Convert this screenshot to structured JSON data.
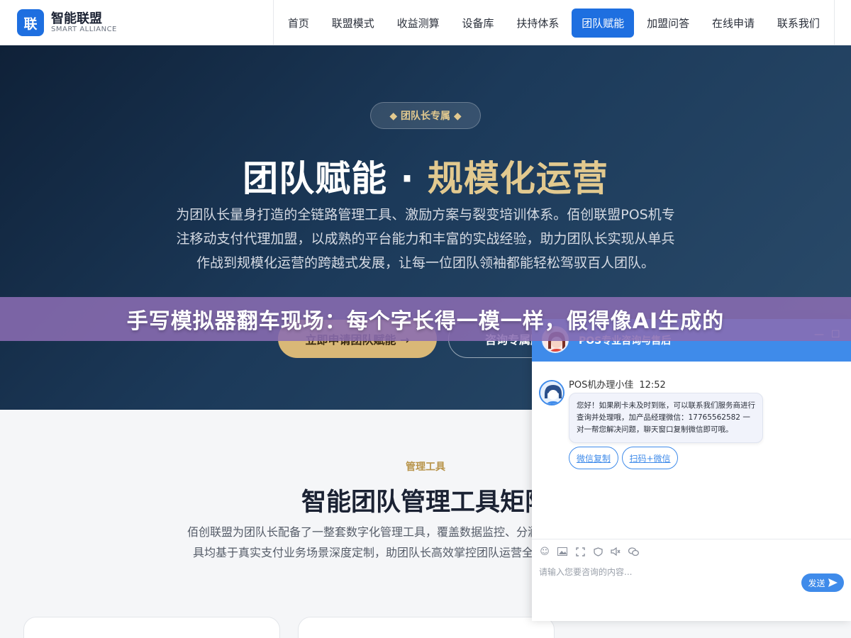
{
  "header": {
    "logo_char": "联",
    "logo_name": "智能联盟",
    "logo_sub": "SMART ALLIANCE",
    "nav": [
      {
        "label": "首页"
      },
      {
        "label": "联盟模式"
      },
      {
        "label": "收益测算"
      },
      {
        "label": "设备库"
      },
      {
        "label": "扶持体系"
      },
      {
        "label": "团队赋能"
      },
      {
        "label": "加盟问答"
      },
      {
        "label": "在线申请"
      },
      {
        "label": "联系我们"
      }
    ],
    "active_nav": "团队赋能"
  },
  "hero": {
    "badge": "◆ 团队长专属 ◆",
    "title_main": "团队赋能 · ",
    "title_gold": "规模化运营",
    "description": "为团队长量身打造的全链路管理工具、激励方案与裂变培训体系。佰创联盟POS机专注移动支付代理加盟，以成熟的平台能力和丰富的实战经验，助力团队长实现从单兵作战到规模化运营的跨越式发展，让每一位团队领袖都能轻松驾驭百人团队。",
    "primary_button": "立即申请团队赋能 →",
    "secondary_button": "咨询专属顾问"
  },
  "banner": {
    "text": "手写模拟器翻车现场：每个字长得一模一样，假得像AI生成的"
  },
  "section": {
    "tag": "管理工具",
    "title": "智能团队管理工具矩阵",
    "description": "佰创联盟为团队长配备了一整套数字化管理工具，覆盖数据监控、分润结算等核心场景。所有工具均基于真实支付业务场景深度定制，助团队长高效掌控团队运营全局，彻底告别繁琐的手工"
  },
  "chat": {
    "title": "POS专业咨询与售后",
    "agent_name": "POS机办理小佳",
    "time": "12:52",
    "message": "您好！如果刷卡未及时到账，可以联系我们服务商进行查询并处理哦，加产品经理微信：17765562582 一对一帮您解决问题，聊天窗口复制微信即可哦。",
    "chip_copy": "微信复制",
    "chip_scan": "扫码+微信",
    "input_placeholder": "请输入您要咨询的内容...",
    "send_label": "发送",
    "min_icon": "—",
    "max_icon": "☐",
    "accent": "#3f8bea"
  }
}
